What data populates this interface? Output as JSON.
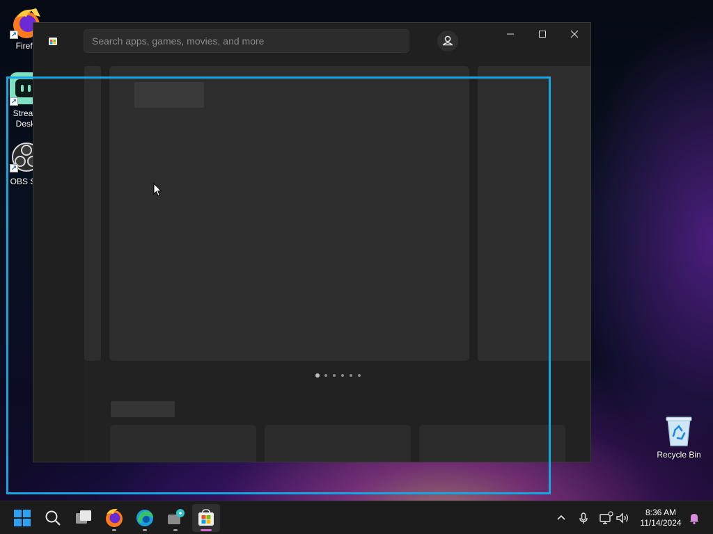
{
  "desktop": {
    "icons": [
      {
        "label": "Firefo",
        "icon": "firefox-icon"
      },
      {
        "label": "Stream\nDeskt",
        "icon": "streamlabs-desktop-icon"
      },
      {
        "label": "OBS Stu",
        "icon": "obs-studio-icon"
      }
    ],
    "recycle_bin": {
      "label": "Recycle Bin",
      "icon": "recycle-bin-icon"
    }
  },
  "store": {
    "app_icon": "microsoft-store-icon",
    "search": {
      "placeholder": "Search apps, games, movies, and more"
    },
    "profile_icon": "profile-icon",
    "window_controls": [
      "minimize-icon",
      "maximize-icon",
      "close-icon"
    ],
    "carousel": {
      "dot_count": 6,
      "active_index": 0
    }
  },
  "taskbar": {
    "apps": [
      "start-icon",
      "search-icon",
      "task-view-icon",
      "firefox-icon",
      "edge-icon",
      "streamlabs-icon",
      "microsoft-store-icon"
    ],
    "tray": [
      "chevron-up-icon",
      "microphone-icon",
      "network-icon",
      "volume-icon"
    ],
    "clock": {
      "time": "8:36 AM",
      "date": "11/14/2024"
    },
    "notification_icon": "bell-icon"
  },
  "colors": {
    "selection_frame": "#17a6e0",
    "store_accent": "#d46bd8",
    "window_bg": "#202020",
    "skeleton": "#2d2d2d"
  }
}
